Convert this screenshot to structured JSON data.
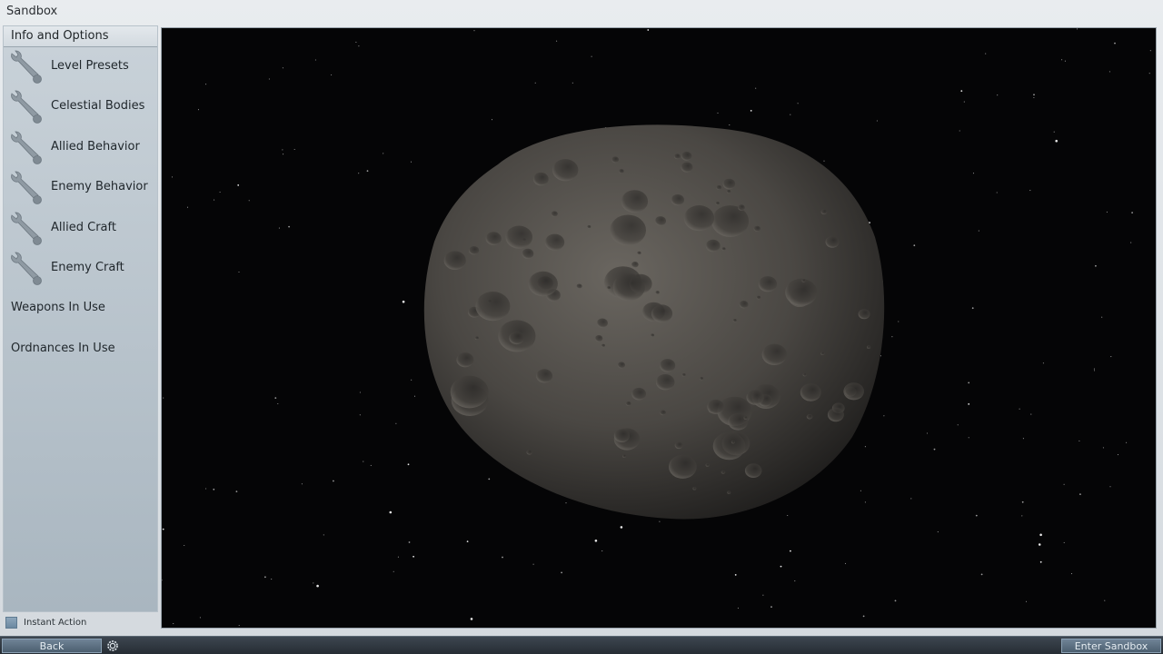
{
  "window": {
    "title": "Sandbox"
  },
  "sidebar": {
    "header": "Info and Options",
    "items": [
      {
        "label": "Level Presets",
        "icon": "wrench-icon"
      },
      {
        "label": "Celestial Bodies",
        "icon": "wrench-icon"
      },
      {
        "label": "Allied Behavior",
        "icon": "wrench-icon"
      },
      {
        "label": "Enemy Behavior",
        "icon": "wrench-icon"
      },
      {
        "label": "Allied Craft",
        "icon": "wrench-icon"
      },
      {
        "label": "Enemy Craft",
        "icon": "wrench-icon"
      },
      {
        "label": "Weapons In Use"
      },
      {
        "label": "Ordnances In Use"
      }
    ]
  },
  "instant_action": {
    "label": "Instant Action",
    "checked": false
  },
  "bottom_bar": {
    "back_label": "Back",
    "enter_label": "Enter Sandbox",
    "settings_icon": "gear-icon"
  },
  "viewport": {
    "subject": "asteroid"
  },
  "colors": {
    "accent": "#6f8396",
    "sidebar": "#b9c4cc",
    "space": "#050506"
  }
}
